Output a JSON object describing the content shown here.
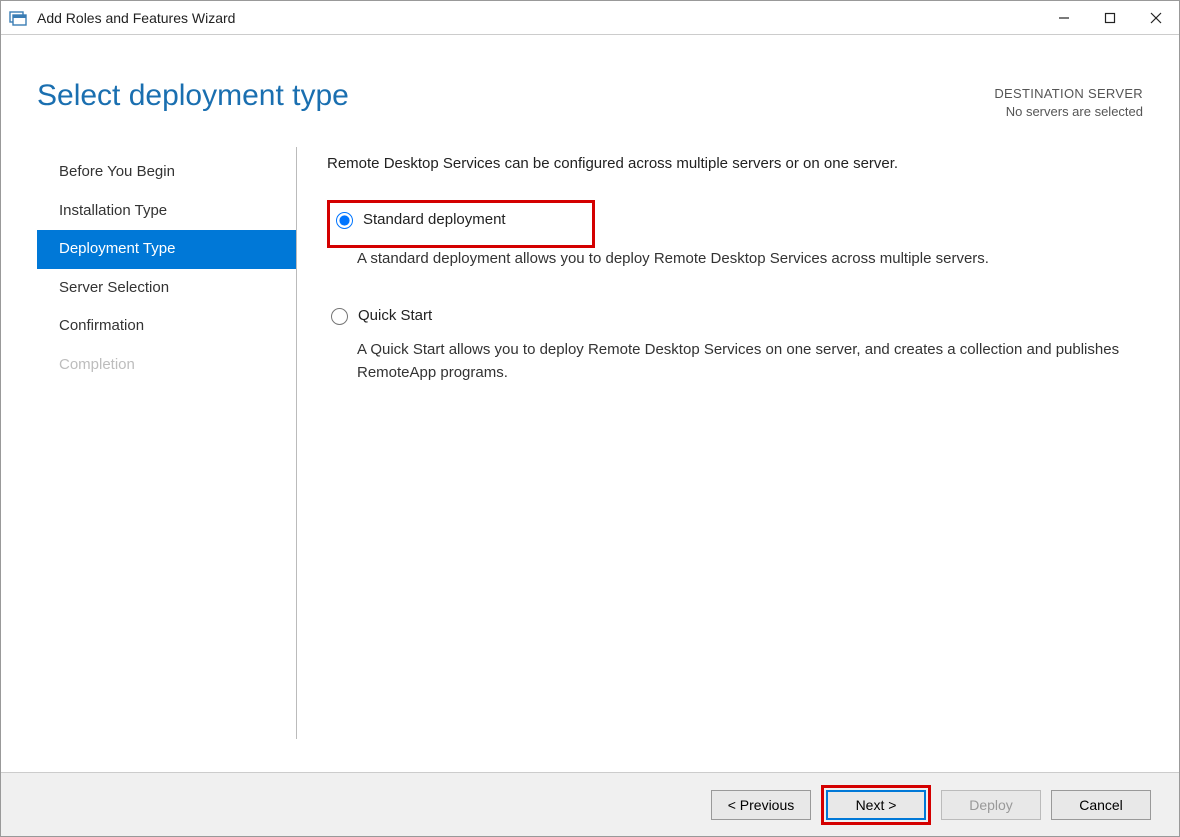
{
  "titlebar": {
    "title": "Add Roles and Features Wizard"
  },
  "header": {
    "title": "Select deployment type",
    "destination_label": "DESTINATION SERVER",
    "destination_value": "No servers are selected"
  },
  "sidebar": {
    "items": [
      {
        "label": "Before You Begin",
        "state": "normal"
      },
      {
        "label": "Installation Type",
        "state": "normal"
      },
      {
        "label": "Deployment Type",
        "state": "active"
      },
      {
        "label": "Server Selection",
        "state": "normal"
      },
      {
        "label": "Confirmation",
        "state": "normal"
      },
      {
        "label": "Completion",
        "state": "disabled"
      }
    ]
  },
  "main": {
    "intro": "Remote Desktop Services can be configured across multiple servers or on one server.",
    "options": [
      {
        "label": "Standard deployment",
        "description": "A standard deployment allows you to deploy Remote Desktop Services across multiple servers.",
        "selected": true,
        "highlighted": true
      },
      {
        "label": "Quick Start",
        "description": "A Quick Start allows you to deploy Remote Desktop Services on one server, and creates a collection and publishes RemoteApp programs.",
        "selected": false,
        "highlighted": false
      }
    ]
  },
  "footer": {
    "previous": "< Previous",
    "next": "Next >",
    "deploy": "Deploy",
    "cancel": "Cancel"
  }
}
